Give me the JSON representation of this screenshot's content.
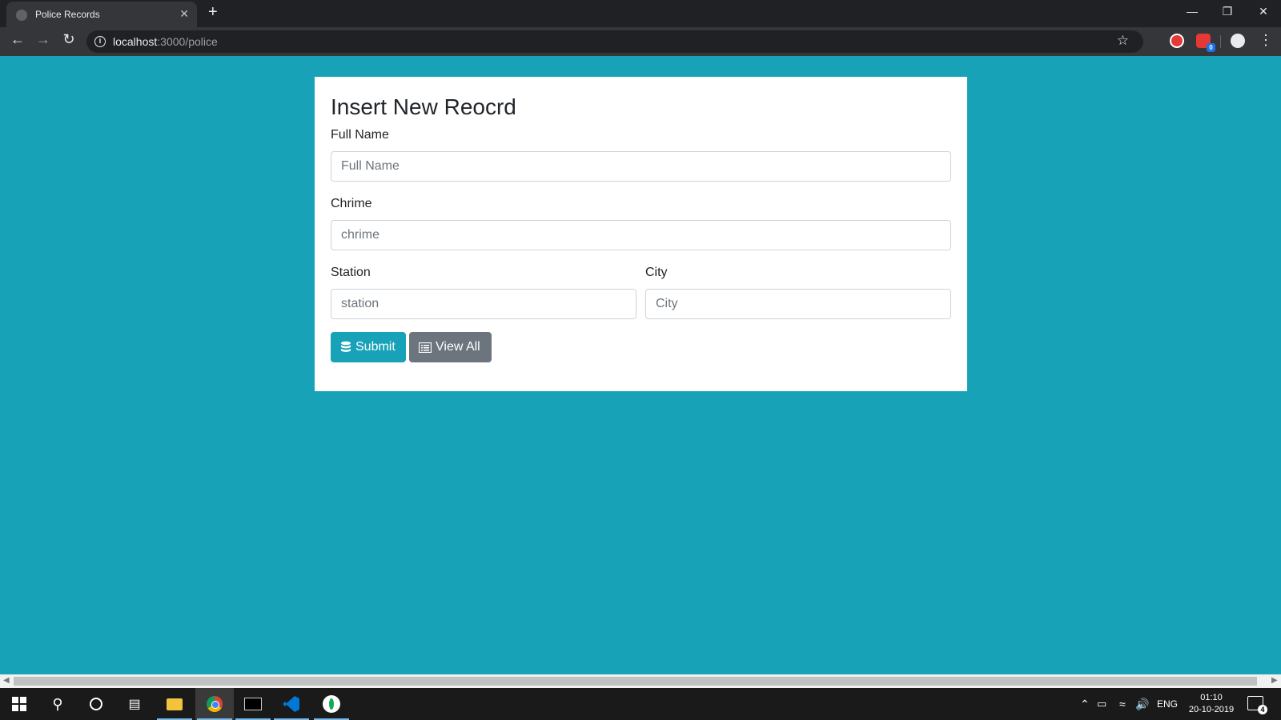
{
  "browser": {
    "tab_title": "Police Records",
    "tab_close": "✕",
    "new_tab": "+",
    "url_host": "localhost",
    "url_path": ":3000/police",
    "extension_badge": "0"
  },
  "form": {
    "title": "Insert New Reocrd",
    "full_name": {
      "label": "Full Name",
      "placeholder": "Full Name"
    },
    "crime": {
      "label": "Chrime",
      "placeholder": "chrime"
    },
    "station": {
      "label": "Station",
      "placeholder": "station"
    },
    "city": {
      "label": "City",
      "placeholder": "City"
    },
    "submit_label": "Submit",
    "view_all_label": "View All"
  },
  "colors": {
    "page_background": "#17a2b8",
    "submit_button": "#17a2b8",
    "view_all_button": "#6c757d"
  },
  "taskbar": {
    "language": "ENG",
    "time": "01:10",
    "date": "20-10-2019",
    "notification_count": "4"
  }
}
